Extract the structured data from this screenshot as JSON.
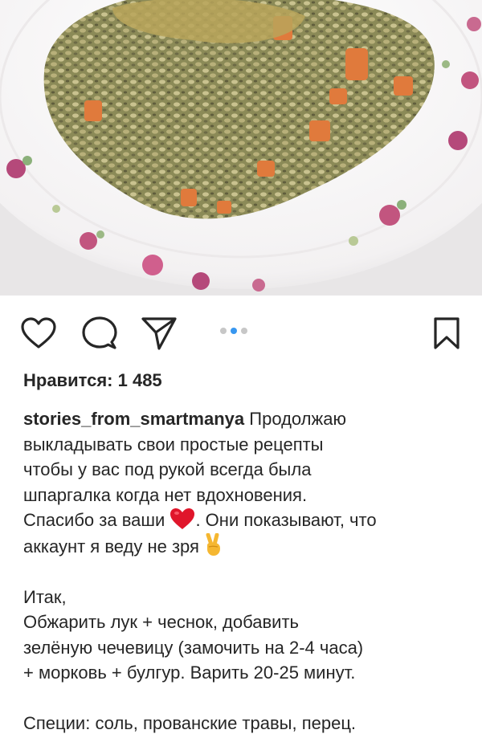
{
  "post": {
    "likes_text": "Нравится: 1 485",
    "username": "stories_from_smartmanya",
    "caption_lines_1": [
      "Продолжаю",
      "выкладывать свои простые рецепты",
      "чтобы у вас под рукой всегда была",
      "шпаргалка когда нет вдохновения.",
      "Спасибо за ваши",
      ". Они показывают, что",
      "аккаунт я веду не зря"
    ],
    "caption_lines_2": [
      "Итак,",
      "Обжарить лук + чеснок, добавить",
      "зелёную чечевицу (замочить на 2-4 часа)",
      "+ морковь + булгур. Варить 20-25 минут."
    ],
    "caption_lines_3": [
      "Специи: соль, прованские травы, перец."
    ],
    "emoji": {
      "heart": "red-heart",
      "hand": "victory-hand"
    }
  },
  "carousel": {
    "total": 3,
    "active": 2
  },
  "icons": {
    "like": "heart-outline-icon",
    "comment": "comment-bubble-icon",
    "share": "paper-plane-icon",
    "save": "bookmark-icon"
  },
  "colors": {
    "active_dot": "#3897f0",
    "inactive_dot": "#c7c7c7",
    "text": "#262626",
    "heart": "#e0162b"
  }
}
